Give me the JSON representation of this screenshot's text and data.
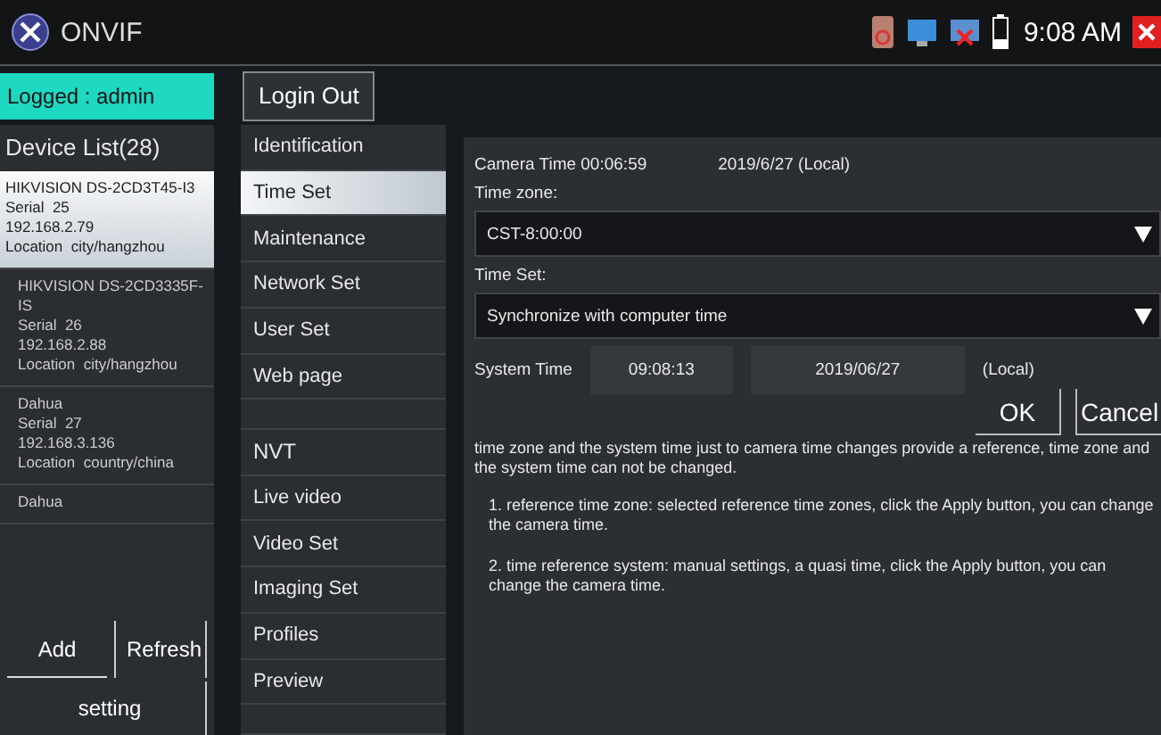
{
  "window": {
    "title": "ONVIF",
    "clock": "9:08 AM"
  },
  "login": {
    "status": "Logged : admin",
    "button": "Login Out"
  },
  "device_list": {
    "title": "Device List(28)",
    "items": [
      {
        "lines": [
          "HIKVISION DS-2CD3T45-I3",
          "Serial  25",
          "192.168.2.79",
          "Location  city/hangzhou"
        ],
        "selected": true
      },
      {
        "lines": [
          "HIKVISION DS-2CD3335F-IS",
          "Serial  26",
          "192.168.2.88",
          "Location  city/hangzhou"
        ],
        "selected": false
      },
      {
        "lines": [
          "Dahua",
          "Serial  27",
          "192.168.3.136",
          "Location  country/china"
        ],
        "selected": false
      },
      {
        "lines": [
          "Dahua"
        ],
        "selected": false
      }
    ],
    "buttons": [
      "Add",
      "Refresh",
      "setting"
    ]
  },
  "menu": [
    {
      "kind": "item",
      "label": "Identification",
      "selected": false
    },
    {
      "kind": "item",
      "label": "Time Set",
      "selected": true
    },
    {
      "kind": "item",
      "label": "Maintenance",
      "selected": false
    },
    {
      "kind": "item",
      "label": "Network Set",
      "selected": false
    },
    {
      "kind": "item",
      "label": "User Set",
      "selected": false
    },
    {
      "kind": "item",
      "label": "Web page",
      "selected": false
    },
    {
      "kind": "blank"
    },
    {
      "kind": "header",
      "label": "NVT"
    },
    {
      "kind": "item",
      "label": "Live video",
      "selected": false
    },
    {
      "kind": "item",
      "label": "Video Set",
      "selected": false
    },
    {
      "kind": "item",
      "label": "Imaging Set",
      "selected": false
    },
    {
      "kind": "item",
      "label": "Profiles",
      "selected": false
    },
    {
      "kind": "item",
      "label": "Preview",
      "selected": false
    },
    {
      "kind": "blank"
    }
  ],
  "time_set": {
    "camera_time": "Camera Time 00:06:59",
    "camera_date": "2019/6/27 (Local)",
    "time_zone_label": "Time zone:",
    "time_zone": "CST-8:00:00",
    "time_set_label": "Time Set:",
    "time_set": "Synchronize with computer time",
    "system_time_label": "System Time",
    "system_time": "09:08:13",
    "system_date": "2019/06/27",
    "local": "(Local)",
    "buttons": [
      "OK",
      "Cancel"
    ],
    "notes": [
      "time zone and the system time just to camera time changes provide a reference, time zone and the system time can not be changed.",
      "1. reference time zone: selected reference time zones, click the Apply button, you can change the camera time.",
      "2. time reference system: manual settings, a quasi time, click the Apply button, you can change the camera time."
    ]
  }
}
